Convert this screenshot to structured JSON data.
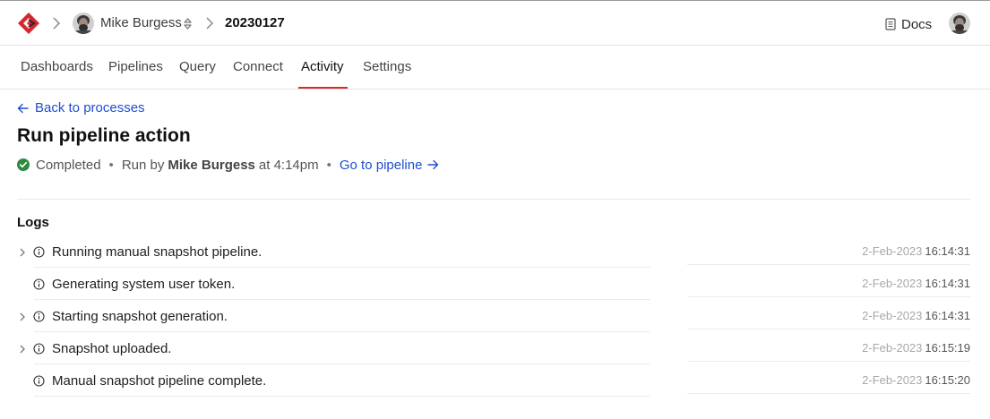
{
  "topbar": {
    "user_name": "Mike Burgess",
    "crumb_id": "20230127",
    "docs_label": "Docs"
  },
  "tabs": [
    {
      "label": "Dashboards"
    },
    {
      "label": "Pipelines"
    },
    {
      "label": "Query"
    },
    {
      "label": "Connect"
    },
    {
      "label": "Activity",
      "active": true
    },
    {
      "label": "Settings"
    }
  ],
  "main": {
    "back_label": "Back to processes",
    "title": "Run pipeline action",
    "status": "Completed",
    "run_by_prefix": "Run by",
    "run_by_user": "Mike Burgess",
    "run_at": "at 4:14pm",
    "goto_label": "Go to pipeline",
    "logs_heading": "Logs"
  },
  "logs": [
    {
      "message": "Running manual snapshot pipeline.",
      "date": "2-Feb-2023",
      "time": "16:14:31",
      "expandable": true
    },
    {
      "message": "Generating system user token.",
      "date": "2-Feb-2023",
      "time": "16:14:31",
      "expandable": false
    },
    {
      "message": "Starting snapshot generation.",
      "date": "2-Feb-2023",
      "time": "16:14:31",
      "expandable": true
    },
    {
      "message": "Snapshot uploaded.",
      "date": "2-Feb-2023",
      "time": "16:15:19",
      "expandable": true
    },
    {
      "message": "Manual snapshot pipeline complete.",
      "date": "2-Feb-2023",
      "time": "16:15:20",
      "expandable": false
    }
  ],
  "colors": {
    "accent_link": "#1d4fcf",
    "active_tab": "#d52b2b",
    "success": "#2e8b3e"
  },
  "icons": [
    "logo-icon",
    "chevron-right-icon",
    "avatar",
    "updown-icon",
    "book-icon",
    "arrow-left-icon",
    "check-circle-icon",
    "arrow-right-icon",
    "info-icon"
  ]
}
